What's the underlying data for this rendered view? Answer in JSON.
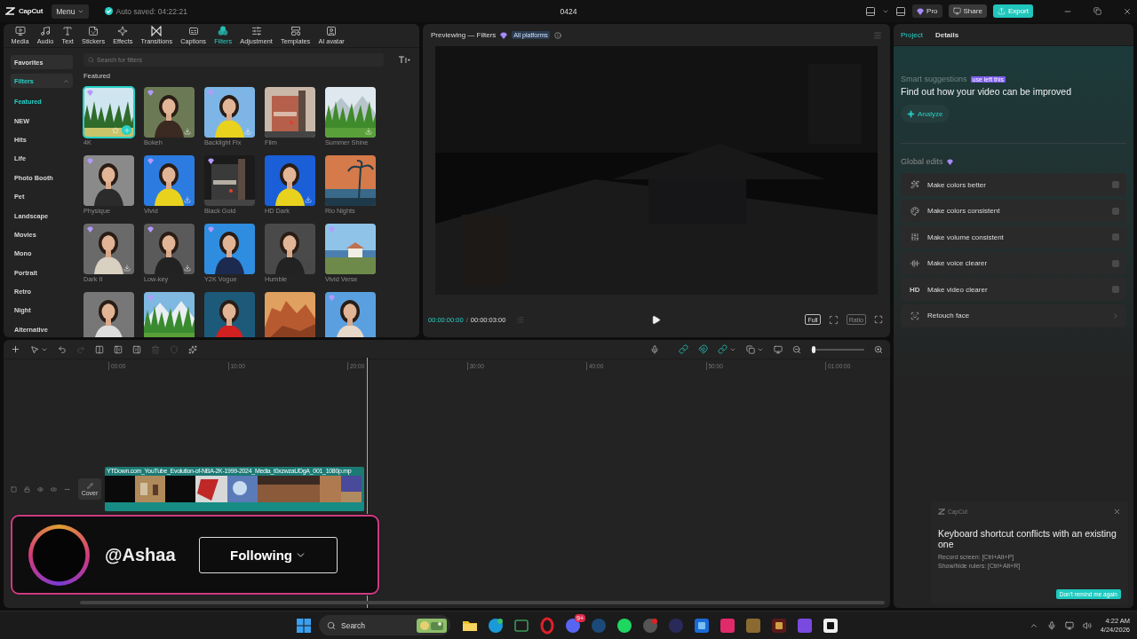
{
  "titlebar": {
    "logo": "CapCut",
    "menu": "Menu",
    "autosave": "Auto saved: 04:22:21",
    "project": "0424",
    "pro": "Pro",
    "share": "Share",
    "export": "Export"
  },
  "toolbar": [
    {
      "label": "Media",
      "selected": false
    },
    {
      "label": "Audio",
      "selected": false
    },
    {
      "label": "Text",
      "selected": false
    },
    {
      "label": "Stickers",
      "selected": false
    },
    {
      "label": "Effects",
      "selected": false
    },
    {
      "label": "Transitions",
      "selected": false
    },
    {
      "label": "Captions",
      "selected": false
    },
    {
      "label": "Filters",
      "selected": true
    },
    {
      "label": "Adjustment",
      "selected": false
    },
    {
      "label": "Templates",
      "selected": false
    },
    {
      "label": "AI avatar",
      "selected": false
    }
  ],
  "sidebar": [
    {
      "label": "Favorites",
      "selected": false
    },
    {
      "label": "Filters",
      "selected": true,
      "expanded": true,
      "children": [
        {
          "label": "Featured",
          "selected": true
        },
        {
          "label": "NEW",
          "selected": false
        },
        {
          "label": "Hits",
          "selected": false
        },
        {
          "label": "Life",
          "selected": false
        },
        {
          "label": "Photo Booth",
          "selected": false
        },
        {
          "label": "Pet",
          "selected": false
        },
        {
          "label": "Landscape",
          "selected": false
        },
        {
          "label": "Movies",
          "selected": false
        },
        {
          "label": "Mono",
          "selected": false
        },
        {
          "label": "Portrait",
          "selected": false
        },
        {
          "label": "Retro",
          "selected": false
        },
        {
          "label": "Night",
          "selected": false
        },
        {
          "label": "Alternative",
          "selected": false
        }
      ]
    }
  ],
  "search": {
    "placeholder": "Search for filters"
  },
  "section": "Featured",
  "filters": [
    {
      "name": "4K",
      "selected": true,
      "premium": true,
      "download": false
    },
    {
      "name": "Bokeh",
      "selected": false,
      "premium": true,
      "download": true
    },
    {
      "name": "Backlight Fix",
      "selected": false,
      "premium": true,
      "download": true
    },
    {
      "name": "Film",
      "selected": false,
      "premium": false,
      "download": false
    },
    {
      "name": "Summer Shine",
      "selected": false,
      "premium": false,
      "download": true
    },
    {
      "name": "Physique",
      "selected": false,
      "premium": true,
      "download": false
    },
    {
      "name": "Vivid",
      "selected": false,
      "premium": true,
      "download": true
    },
    {
      "name": "Black Gold",
      "selected": false,
      "premium": true,
      "download": false
    },
    {
      "name": "HD Dark",
      "selected": false,
      "premium": false,
      "download": true
    },
    {
      "name": "Rio Nights",
      "selected": false,
      "premium": false,
      "download": false
    },
    {
      "name": "Dark II",
      "selected": false,
      "premium": true,
      "download": true
    },
    {
      "name": "Low-key",
      "selected": false,
      "premium": true,
      "download": true
    },
    {
      "name": "Y2K Vogue",
      "selected": false,
      "premium": true,
      "download": false
    },
    {
      "name": "Humble",
      "selected": false,
      "premium": false,
      "download": false
    },
    {
      "name": "Vivid Verse",
      "selected": false,
      "premium": true,
      "download": false
    },
    {
      "selected": false,
      "premium": false,
      "download": false
    },
    {
      "selected": false,
      "premium": true,
      "download": false
    },
    {
      "selected": false,
      "premium": false,
      "download": false
    },
    {
      "selected": false,
      "premium": false,
      "download": false
    },
    {
      "selected": false,
      "premium": true,
      "download": false
    }
  ],
  "preview": {
    "title": "Previewing — Filters",
    "badge": "All platforms",
    "current_time": "00:00:00:00",
    "separator": "/",
    "duration": "00:00:03:00",
    "view_buttons": [
      {
        "label": "Full",
        "disabled": false
      },
      {
        "label": "Ratio",
        "disabled": true
      }
    ]
  },
  "timeline": {
    "zoom": {
      "level": 0.02
    },
    "ruler": [
      "00:00",
      "10:00",
      "20:00",
      "30:00",
      "40:00",
      "50:00",
      "01:00:00"
    ],
    "cover": "Cover",
    "clip_title": "YTDown.com_YouTube_Evolution-of-NBA-2K-1999-2024_Media_t0xzwzaUDgA_001_1080p.mp"
  },
  "inspector": {
    "tabs": [
      {
        "label": "Project",
        "selected": true
      },
      {
        "label": "Details",
        "selected": false
      }
    ],
    "suggest_title": "Smart suggestions",
    "suggest_badge": "use left this",
    "headline": "Find out how your video can be improved",
    "analyze": "Analyze",
    "global_title": "Global edits",
    "edits": [
      {
        "kind": "toggle",
        "label": "Make colors better",
        "on": false
      },
      {
        "kind": "toggle",
        "label": "Make colors consistent",
        "on": false
      },
      {
        "kind": "toggle",
        "label": "Make volume consistent",
        "on": false
      },
      {
        "kind": "toggle",
        "label": "Make voice clearer",
        "on": false
      },
      {
        "kind": "toggle",
        "label": "Make video clearer",
        "on": false,
        "icon_text": "HD"
      },
      {
        "kind": "link",
        "label": "Retouch face"
      }
    ]
  },
  "notification": {
    "app": "CapCut",
    "title": "Keyboard shortcut conflicts with an existing one",
    "lines": [
      "Record screen: [Ctrl+Alt+P]",
      "Show/hide rulers: [Ctrl+Alt+R]"
    ],
    "action": "Don't remind me again"
  },
  "profile_overlay": {
    "handle": "@Ashaa",
    "button": "Following"
  },
  "taskbar": {
    "search": "Search",
    "badge": "9+",
    "time": "4:22 AM",
    "date": "4/24/2026"
  }
}
